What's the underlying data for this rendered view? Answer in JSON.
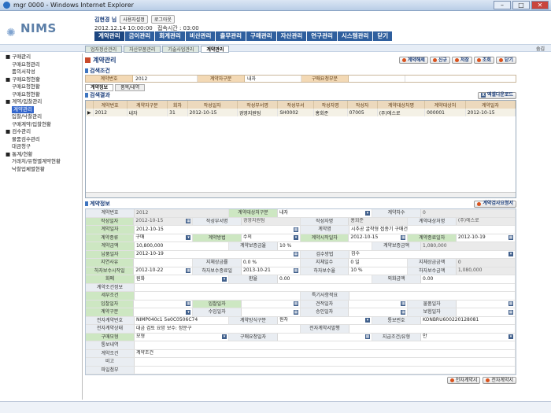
{
  "window": {
    "title": "mgr 0000 - Windows Internet Explorer"
  },
  "header": {
    "logo": "NIMS",
    "user_name": "김현경 님",
    "user_btn1": "사용자설정",
    "user_btn2": "로그아웃",
    "datetime": "2012.12.14 10:00:00",
    "login_time": "접속시간 : 03:00",
    "menu": [
      "계약관리",
      "금이관리",
      "회계관리",
      "비산관리",
      "출무관리",
      "구매관리",
      "자산관리",
      "연구관리",
      "시스템관리",
      "닫기"
    ],
    "hide_label": "숨김"
  },
  "tabs": [
    "업자정산관리",
    "자산부품관리",
    "기술사업관리",
    "계약관리"
  ],
  "sidebar": [
    {
      "label": "■ 구매관리",
      "level": 1
    },
    {
      "label": "구매요청관리",
      "level": 2
    },
    {
      "label": "품의서작성",
      "level": 2
    },
    {
      "label": "■ 구매요청현황",
      "level": 1
    },
    {
      "label": "구매요청현황",
      "level": 2
    },
    {
      "label": "구매요청현황",
      "level": 2
    },
    {
      "label": "■ 계약/입찰관리",
      "level": 1
    },
    {
      "label": "계약관리",
      "level": 2,
      "selected": true
    },
    {
      "label": "입찰/낙찰관리",
      "level": 2
    },
    {
      "label": "구매계약/입찰현황",
      "level": 2
    },
    {
      "label": "■ 검수관리",
      "level": 1
    },
    {
      "label": "물품검수관리",
      "level": 2
    },
    {
      "label": "대금청구",
      "level": 2
    },
    {
      "label": "■ 통계/현황",
      "level": 1
    },
    {
      "label": "거래처/유형별계약현황",
      "level": 2
    },
    {
      "label": "낙찰업체별현황",
      "level": 2
    }
  ],
  "page": {
    "title": "계약관리",
    "buttons": [
      "계약해제",
      "신규",
      "저장",
      "조회",
      "닫기"
    ]
  },
  "search": {
    "title": "검색조건",
    "fields": [
      {
        "label": "계약번호",
        "value": "2012"
      },
      {
        "label": "계약자구분",
        "value": "내자"
      },
      {
        "label": "구매요청부분",
        "value": ""
      }
    ]
  },
  "subtabs": [
    "계약정보",
    "품목/내역"
  ],
  "result": {
    "title": "검색결과",
    "excel": "엑셀다운로드",
    "columns": [
      "계약번호",
      "계약자구분",
      "회차",
      "작성일자",
      "작성부서명",
      "작성부서",
      "작성자명",
      "작성자",
      "계약대상처명",
      "계약대상처",
      "계약일자"
    ],
    "rows": [
      [
        "2012",
        "내자",
        "31",
        "2012-10-15",
        "경영지원팀",
        "SH0002",
        "홍회준",
        "07005",
        "(주)에스로",
        "000001",
        "2012-10-15"
      ]
    ]
  },
  "detail": {
    "title": "계약정보",
    "print_btn": "계약검사요청서",
    "rows": [
      [
        [
          "계약번호",
          "2012"
        ],
        [
          "계약대상처구분",
          "내자"
        ],
        [
          "계약차수",
          "0"
        ]
      ],
      [
        [
          "작성일자",
          "2012-10-15"
        ],
        [
          "작성부서명",
          "경영지원팀"
        ],
        [
          "작성자명",
          "홍회준"
        ],
        [
          "계약대상처명",
          "(주)에스로"
        ]
      ],
      [
        [
          "계약일자",
          "2012-10-15"
        ],
        [
          "계약명",
          "시추공 굴착형 접종기 구매건"
        ]
      ],
      [
        [
          "계약종류",
          "구매"
        ],
        [
          "계약방법",
          "수의"
        ],
        [
          "계약시작일자",
          "2012-10-15"
        ],
        [
          "계약종료일자",
          "2012-10-19"
        ]
      ],
      [
        [
          "계약금액",
          "10,800,000"
        ],
        [
          "계약보증금율",
          "10 %"
        ],
        [
          "계약보증금액",
          "1,080,000"
        ]
      ],
      [
        [
          "납품일자",
          "2012-10-19"
        ],
        [
          "검수방법",
          "검수"
        ]
      ],
      [
        [
          "지연사유",
          ""
        ],
        [
          "지체상금률",
          "0.0 %"
        ],
        [
          "지체일수",
          "0 일"
        ],
        [
          "지체상금금액",
          "0"
        ]
      ],
      [
        [
          "하자보수시작일",
          "2012-10-22"
        ],
        [
          "하자보수종료일",
          "2013-10-21"
        ],
        [
          "하자보수율",
          "10 %"
        ],
        [
          "하자보수금액",
          "1,080,000"
        ]
      ],
      [
        [
          "화폐",
          "원화"
        ],
        [
          "환율",
          "0.00"
        ],
        [
          "외화금액",
          "0.00"
        ]
      ],
      [
        [
          "계약조건정보",
          ""
        ]
      ],
      [
        [
          "세부조건",
          ""
        ],
        [
          "특기사항적요",
          ""
        ]
      ],
      [
        [
          "입찰일자",
          ""
        ],
        [
          "입찰일자",
          ""
        ],
        [
          "견적일자",
          ""
        ],
        [
          "물품일자",
          ""
        ]
      ],
      [
        [
          "계약구분",
          ""
        ],
        [
          "수입일자",
          ""
        ],
        [
          "승인일자",
          ""
        ],
        [
          "보험일자",
          ""
        ]
      ],
      [
        [
          "전자계약번호",
          "NIMP040c1 5e0C0506C74"
        ],
        [
          "계약방식구분",
          "원자"
        ],
        [
          "통보번호",
          "KONBRU600220128081"
        ]
      ],
      [
        [
          "전자계약상태",
          "대금 검토 요망 보수: 정문구"
        ],
        [
          "전자계약서발행",
          ""
        ]
      ],
      [
        [
          "구매모형",
          "모형"
        ],
        [
          "구매요청일자",
          ""
        ],
        [
          "지급조건/유형",
          "안"
        ]
      ],
      [
        [
          "통보내역",
          ""
        ]
      ],
      [
        [
          "계약조건",
          "계약조건"
        ]
      ],
      [
        [
          "비고",
          ""
        ]
      ],
      [
        [
          "파일첨부",
          ""
        ]
      ]
    ],
    "bottom_btns": [
      "전자계약서",
      "전자계약서"
    ]
  }
}
